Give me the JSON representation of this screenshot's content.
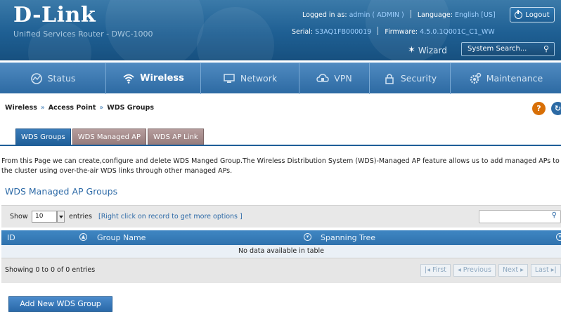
{
  "header": {
    "logo": "D-Link",
    "subtitle": "Unified Services Router - DWC-1000",
    "logged_in_label": "Logged in as:",
    "logged_in_value": "admin ( ADMIN )",
    "language_label": "Language:",
    "language_value": "English [US]",
    "serial_label": "Serial:",
    "serial_value": "S3AQ1FB000019",
    "firmware_label": "Firmware:",
    "firmware_value": "4.5.0.1Q001C_C1_WW",
    "logout_label": "Logout",
    "wizard_label": "Wizard",
    "search_placeholder": "System Search..."
  },
  "nav": [
    {
      "label": "Status",
      "icon": "status-icon",
      "active": false
    },
    {
      "label": "Wireless",
      "icon": "wifi-icon",
      "active": true
    },
    {
      "label": "Network",
      "icon": "network-icon",
      "active": false
    },
    {
      "label": "VPN",
      "icon": "vpn-icon",
      "active": false
    },
    {
      "label": "Security",
      "icon": "lock-icon",
      "active": false
    },
    {
      "label": "Maintenance",
      "icon": "gear-icon",
      "active": false
    }
  ],
  "breadcrumb": [
    "Wireless",
    "Access Point",
    "WDS Groups"
  ],
  "tabs": [
    "WDS Groups",
    "WDS Managed AP",
    "WDS AP Link"
  ],
  "description": "From this Page we can create,configure and delete WDS Manged Group.The Wireless Distribution System (WDS)-Managed AP feature allows us to add managed APs to the cluster using over-the-air WDS links through other managed APs.",
  "section_title": "WDS Managed AP Groups",
  "table": {
    "show_label": "Show",
    "entries_value": "10",
    "entries_label": "entries",
    "hint": "[Right click on record to get more options ]",
    "columns": [
      "ID",
      "Group Name",
      "Spanning Tree"
    ],
    "empty_message": "No data available in table",
    "info": "Showing 0 to 0 of 0 entries",
    "pager": [
      "First",
      "Previous",
      "Next",
      "Last"
    ]
  },
  "add_button": "Add New WDS Group",
  "colors": {
    "header_blue": "#1e5f93",
    "nav_blue": "#2d6aa3",
    "active_tab": "#1f5f99",
    "inactive_tab": "#957b7b",
    "help_orange": "#d86f06"
  }
}
